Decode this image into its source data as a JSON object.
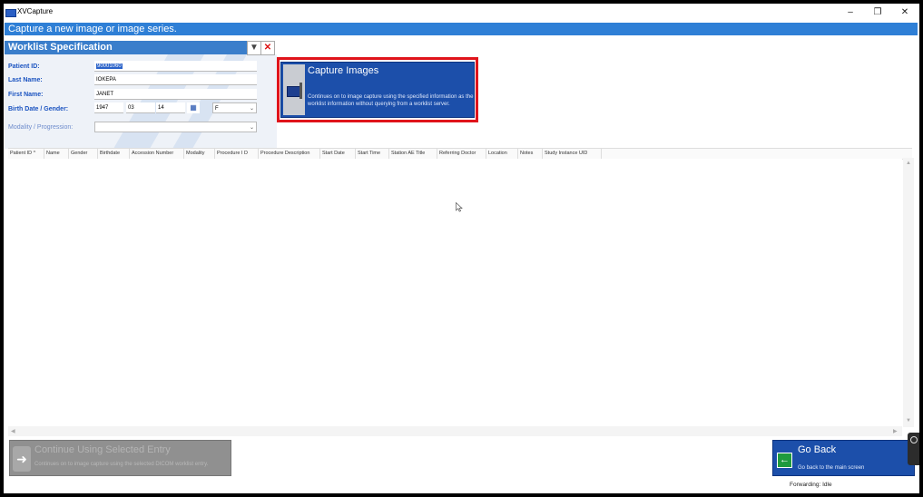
{
  "window": {
    "title": "XVCapture"
  },
  "banner": {
    "text": "Capture a new image or image series."
  },
  "worklist_spec": {
    "title": "Worklist Specification",
    "labels": {
      "patient_id": "Patient ID:",
      "last_name": "Last Name:",
      "first_name": "First Name:",
      "birth_gender": "Birth Date / Gender:",
      "modality": "Modality / Progression:"
    },
    "values": {
      "patient_id": "90001060",
      "last_name": "IOKEPA",
      "first_name": "JANET",
      "birth_year": "1947",
      "birth_month": "03",
      "birth_day": "14",
      "gender": "F",
      "modality": ""
    }
  },
  "capture_button": {
    "title": "Capture Images",
    "description": "Continues on to image capture using the specified information as the worklist information without querying from a worklist server."
  },
  "grid": {
    "columns": [
      "Patient ID ^",
      "Name",
      "Gender",
      "Birthdate",
      "Accession Number",
      "Modality",
      "Procedure I D",
      "Procedure Description",
      "Start Date",
      "Start Time",
      "Station AE Title",
      "Referring Doctor",
      "Location",
      "Notes",
      "Study Instance UID"
    ]
  },
  "continue_button": {
    "title": "Continue Using Selected Entry",
    "description": "Continues on to image capture using the selected DICOM worklist entry."
  },
  "back_button": {
    "title": "Go Back",
    "description": "Go back to the main screen"
  },
  "status": {
    "forwarding": "Forwarding: Idle"
  },
  "colors": {
    "accent": "#1c4faa",
    "banner": "#2e7fd6",
    "highlight": "#e0141b"
  }
}
